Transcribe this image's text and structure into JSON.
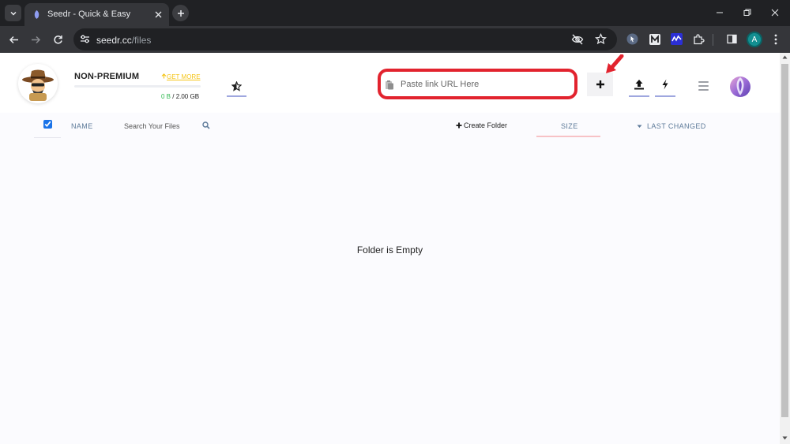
{
  "browser": {
    "tab_title": "Seedr - Quick & Easy",
    "url_host": "seedr.cc",
    "url_path": "/files",
    "profile_initial": "A"
  },
  "header": {
    "plan_label": "NON-PREMIUM",
    "get_more_label": "GET MORE",
    "storage_used": "0 B",
    "storage_separator": " / ",
    "storage_total": "2.00 GB",
    "storage_fraction": 0,
    "magnet_placeholder": "Paste link URL Here"
  },
  "columns": {
    "name_label": "NAME",
    "search_placeholder": "Search Your Files",
    "create_folder_label": "Create Folder",
    "size_label": "SIZE",
    "last_changed_label": "LAST CHANGED"
  },
  "main": {
    "empty_message": "Folder is Empty"
  },
  "colors": {
    "highlight_red": "#e2232e",
    "accent_underline": "#9fa7df",
    "get_more_yellow": "#f5c518",
    "storage_green": "#2fb84f"
  }
}
